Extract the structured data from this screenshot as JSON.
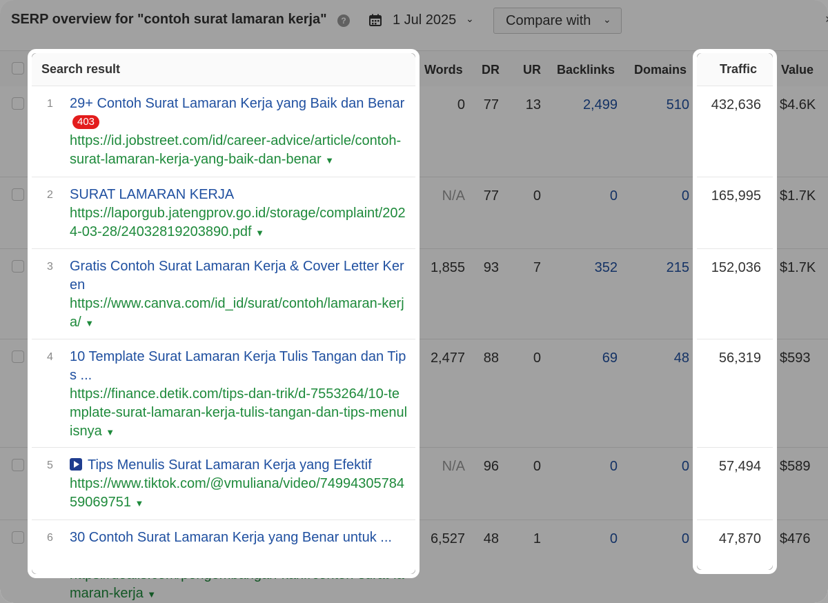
{
  "header": {
    "title": "SERP overview for \"contoh surat lamaran kerja\"",
    "help_glyph": "?",
    "date": "1 Jul 2025",
    "compare_label": "Compare with"
  },
  "columns": {
    "search_result": "Search result",
    "words": "Words",
    "dr": "DR",
    "ur": "UR",
    "backlinks": "Backlinks",
    "domains": "Domains",
    "traffic": "Traffic",
    "value": "Value"
  },
  "rows": [
    {
      "num": "1",
      "title": "29+ Contoh Surat Lamaran Kerja yang Baik dan Benar",
      "badge": "403",
      "url": "https://id.jobstreet.com/id/career-advice/article/contoh-surat-lamaran-kerja-yang-baik-dan-benar",
      "words": "0",
      "dr": "77",
      "ur": "13",
      "backlinks": "2,499",
      "domains": "510",
      "traffic": "432,636",
      "value": "$4.6K"
    },
    {
      "num": "2",
      "title": "SURAT LAMARAN KERJA",
      "url": "https://laporgub.jatengprov.go.id/storage/complaint/2024-03-28/24032819203890.pdf",
      "words": "N/A",
      "dr": "77",
      "ur": "0",
      "backlinks": "0",
      "domains": "0",
      "traffic": "165,995",
      "value": "$1.7K"
    },
    {
      "num": "3",
      "title": "Gratis Contoh Surat Lamaran Kerja & Cover Letter Keren",
      "url": "https://www.canva.com/id_id/surat/contoh/lamaran-kerja/",
      "words": "1,855",
      "dr": "93",
      "ur": "7",
      "backlinks": "352",
      "domains": "215",
      "traffic": "152,036",
      "value": "$1.7K"
    },
    {
      "num": "4",
      "title": "10 Template Surat Lamaran Kerja Tulis Tangan dan Tips ...",
      "url": "https://finance.detik.com/tips-dan-trik/d-7553264/10-template-surat-lamaran-kerja-tulis-tangan-dan-tips-menulisnya",
      "words": "2,477",
      "dr": "88",
      "ur": "0",
      "backlinks": "69",
      "domains": "48",
      "traffic": "56,319",
      "value": "$593"
    },
    {
      "num": "5",
      "title": "Tips Menulis Surat Lamaran Kerja yang Efektif",
      "video": true,
      "url": "https://www.tiktok.com/@vmuliana/video/7499430578459069751",
      "words": "N/A",
      "dr": "96",
      "ur": "0",
      "backlinks": "0",
      "domains": "0",
      "traffic": "57,494",
      "value": "$589"
    },
    {
      "num": "6",
      "title": "30 Contoh Surat Lamaran Kerja yang Benar untuk ...",
      "url": "https://dealls.com/pengembangan-karir/contoh-surat-lamaran-kerja",
      "words": "6,527",
      "dr": "48",
      "ur": "1",
      "backlinks": "0",
      "domains": "0",
      "traffic": "47,870",
      "value": "$476"
    }
  ],
  "colors": {
    "title_link": "#2050a0",
    "url_link": "#1e8a3b",
    "badge": "#e31c1c"
  }
}
